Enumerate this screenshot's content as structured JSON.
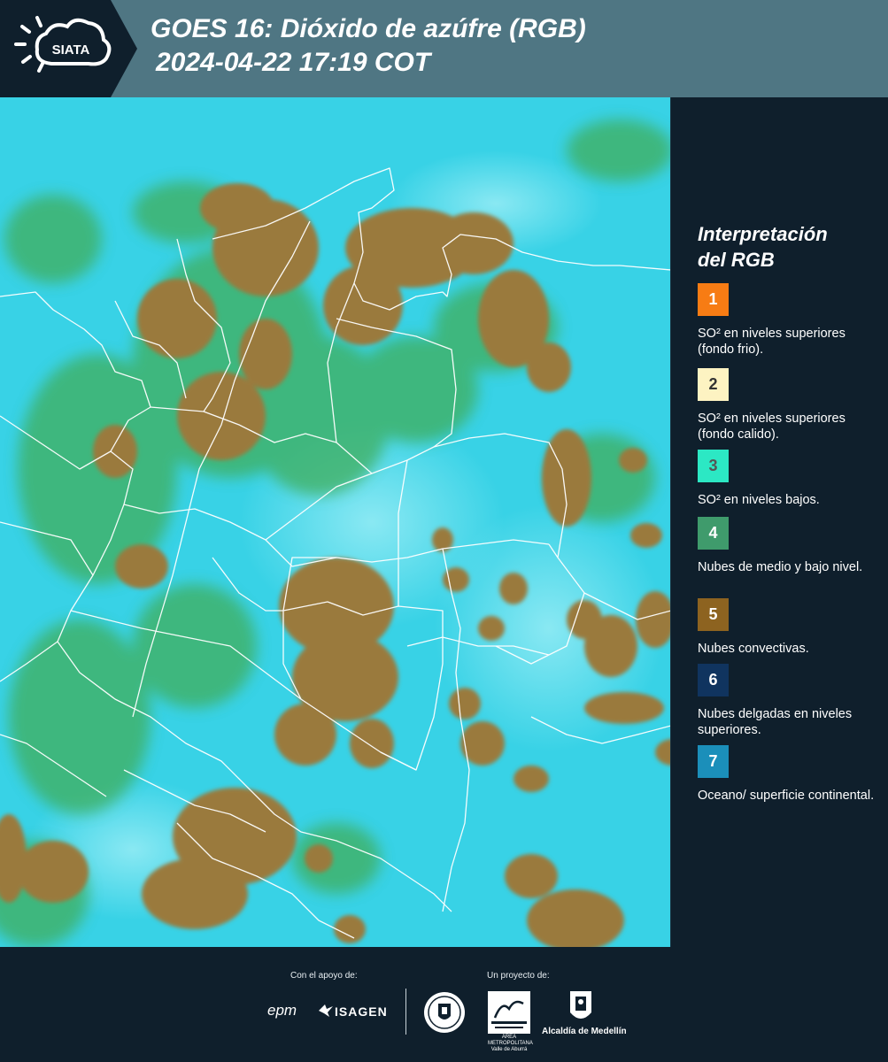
{
  "header": {
    "logo_text": "SIATA",
    "title_line1": "GOES 16: Dióxido de azúfre (RGB)",
    "title_line2": "2024-04-22 17:19 COT"
  },
  "map": {
    "base_color": "#38d2e6",
    "convective_color": "#9a7a3e",
    "green_color": "#3fae5c",
    "border_color": "#ffffff"
  },
  "legend": {
    "title_line1": "Interpretación",
    "title_line2": "del RGB",
    "items": [
      {
        "number": "1",
        "label": "SO² en niveles superiores (fondo frio).",
        "color": "#f77c14",
        "text_color": "#ffffff"
      },
      {
        "number": "2",
        "label": "SO² en niveles superiores (fondo calido).",
        "color": "#fdf3c2",
        "text_color": "#333333"
      },
      {
        "number": "3",
        "label": "SO² en niveles bajos.",
        "color": "#2ce8c4",
        "text_color": "#555555"
      },
      {
        "number": "4",
        "label": "Nubes de medio y bajo nivel.",
        "color": "#3f9b6c",
        "text_color": "#ffffff"
      },
      {
        "number": "5",
        "label": "Nubes convectivas.",
        "color": "#8d6320",
        "text_color": "#ffffff"
      },
      {
        "number": "6",
        "label": "Nubes delgadas en niveles superiores.",
        "color": "#10345f",
        "text_color": "#ffffff"
      },
      {
        "number": "7",
        "label": "Oceano/ superficie continental.",
        "color": "#1b8fba",
        "text_color": "#ffffff"
      }
    ]
  },
  "footer": {
    "support_label": "Con el apoyo de:",
    "project_label": "Un proyecto de:",
    "sponsors": [
      "epm",
      "ISAGEN"
    ],
    "partners": [
      "ÁREA METROPOLITANA",
      "Valle de Aburrá",
      "Alcaldía de Medellín"
    ]
  }
}
